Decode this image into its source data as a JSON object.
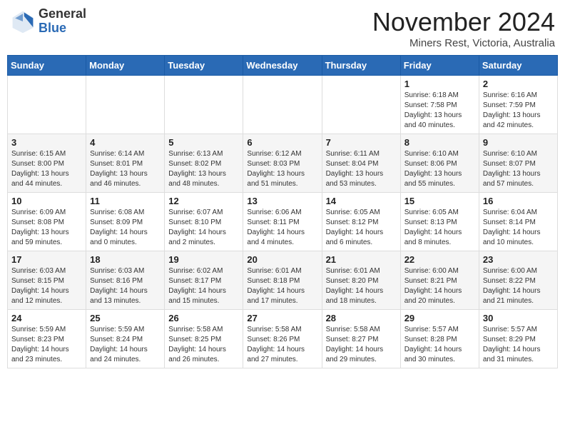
{
  "header": {
    "logo_general": "General",
    "logo_blue": "Blue",
    "title": "November 2024",
    "subtitle": "Miners Rest, Victoria, Australia"
  },
  "days_of_week": [
    "Sunday",
    "Monday",
    "Tuesday",
    "Wednesday",
    "Thursday",
    "Friday",
    "Saturday"
  ],
  "weeks": [
    [
      {
        "day": "",
        "info": ""
      },
      {
        "day": "",
        "info": ""
      },
      {
        "day": "",
        "info": ""
      },
      {
        "day": "",
        "info": ""
      },
      {
        "day": "",
        "info": ""
      },
      {
        "day": "1",
        "info": "Sunrise: 6:18 AM\nSunset: 7:58 PM\nDaylight: 13 hours\nand 40 minutes."
      },
      {
        "day": "2",
        "info": "Sunrise: 6:16 AM\nSunset: 7:59 PM\nDaylight: 13 hours\nand 42 minutes."
      }
    ],
    [
      {
        "day": "3",
        "info": "Sunrise: 6:15 AM\nSunset: 8:00 PM\nDaylight: 13 hours\nand 44 minutes."
      },
      {
        "day": "4",
        "info": "Sunrise: 6:14 AM\nSunset: 8:01 PM\nDaylight: 13 hours\nand 46 minutes."
      },
      {
        "day": "5",
        "info": "Sunrise: 6:13 AM\nSunset: 8:02 PM\nDaylight: 13 hours\nand 48 minutes."
      },
      {
        "day": "6",
        "info": "Sunrise: 6:12 AM\nSunset: 8:03 PM\nDaylight: 13 hours\nand 51 minutes."
      },
      {
        "day": "7",
        "info": "Sunrise: 6:11 AM\nSunset: 8:04 PM\nDaylight: 13 hours\nand 53 minutes."
      },
      {
        "day": "8",
        "info": "Sunrise: 6:10 AM\nSunset: 8:06 PM\nDaylight: 13 hours\nand 55 minutes."
      },
      {
        "day": "9",
        "info": "Sunrise: 6:10 AM\nSunset: 8:07 PM\nDaylight: 13 hours\nand 57 minutes."
      }
    ],
    [
      {
        "day": "10",
        "info": "Sunrise: 6:09 AM\nSunset: 8:08 PM\nDaylight: 13 hours\nand 59 minutes."
      },
      {
        "day": "11",
        "info": "Sunrise: 6:08 AM\nSunset: 8:09 PM\nDaylight: 14 hours\nand 0 minutes."
      },
      {
        "day": "12",
        "info": "Sunrise: 6:07 AM\nSunset: 8:10 PM\nDaylight: 14 hours\nand 2 minutes."
      },
      {
        "day": "13",
        "info": "Sunrise: 6:06 AM\nSunset: 8:11 PM\nDaylight: 14 hours\nand 4 minutes."
      },
      {
        "day": "14",
        "info": "Sunrise: 6:05 AM\nSunset: 8:12 PM\nDaylight: 14 hours\nand 6 minutes."
      },
      {
        "day": "15",
        "info": "Sunrise: 6:05 AM\nSunset: 8:13 PM\nDaylight: 14 hours\nand 8 minutes."
      },
      {
        "day": "16",
        "info": "Sunrise: 6:04 AM\nSunset: 8:14 PM\nDaylight: 14 hours\nand 10 minutes."
      }
    ],
    [
      {
        "day": "17",
        "info": "Sunrise: 6:03 AM\nSunset: 8:15 PM\nDaylight: 14 hours\nand 12 minutes."
      },
      {
        "day": "18",
        "info": "Sunrise: 6:03 AM\nSunset: 8:16 PM\nDaylight: 14 hours\nand 13 minutes."
      },
      {
        "day": "19",
        "info": "Sunrise: 6:02 AM\nSunset: 8:17 PM\nDaylight: 14 hours\nand 15 minutes."
      },
      {
        "day": "20",
        "info": "Sunrise: 6:01 AM\nSunset: 8:18 PM\nDaylight: 14 hours\nand 17 minutes."
      },
      {
        "day": "21",
        "info": "Sunrise: 6:01 AM\nSunset: 8:20 PM\nDaylight: 14 hours\nand 18 minutes."
      },
      {
        "day": "22",
        "info": "Sunrise: 6:00 AM\nSunset: 8:21 PM\nDaylight: 14 hours\nand 20 minutes."
      },
      {
        "day": "23",
        "info": "Sunrise: 6:00 AM\nSunset: 8:22 PM\nDaylight: 14 hours\nand 21 minutes."
      }
    ],
    [
      {
        "day": "24",
        "info": "Sunrise: 5:59 AM\nSunset: 8:23 PM\nDaylight: 14 hours\nand 23 minutes."
      },
      {
        "day": "25",
        "info": "Sunrise: 5:59 AM\nSunset: 8:24 PM\nDaylight: 14 hours\nand 24 minutes."
      },
      {
        "day": "26",
        "info": "Sunrise: 5:58 AM\nSunset: 8:25 PM\nDaylight: 14 hours\nand 26 minutes."
      },
      {
        "day": "27",
        "info": "Sunrise: 5:58 AM\nSunset: 8:26 PM\nDaylight: 14 hours\nand 27 minutes."
      },
      {
        "day": "28",
        "info": "Sunrise: 5:58 AM\nSunset: 8:27 PM\nDaylight: 14 hours\nand 29 minutes."
      },
      {
        "day": "29",
        "info": "Sunrise: 5:57 AM\nSunset: 8:28 PM\nDaylight: 14 hours\nand 30 minutes."
      },
      {
        "day": "30",
        "info": "Sunrise: 5:57 AM\nSunset: 8:29 PM\nDaylight: 14 hours\nand 31 minutes."
      }
    ]
  ]
}
